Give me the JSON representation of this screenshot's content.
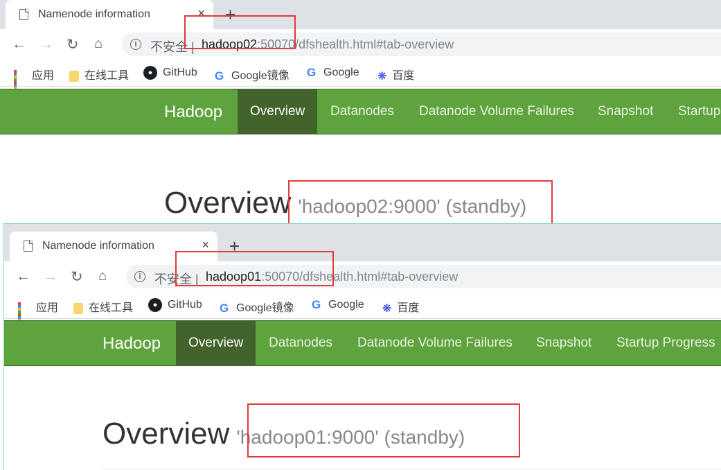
{
  "windows": [
    {
      "tab_title": "Namenode information",
      "tab_close": "×",
      "new_tab": "+",
      "insecure_label": "不安全 |",
      "url_host": "hadoop02",
      "url_rest": ":50070/dfshealth.html#tab-overview",
      "bookmarks": [
        "应用",
        "在线工具",
        "GitHub",
        "Google镜像",
        "Google",
        "百度"
      ],
      "brand": "Hadoop",
      "nav": [
        "Overview",
        "Datanodes",
        "Datanode Volume Failures",
        "Snapshot",
        "Startup Progress"
      ],
      "heading": "Overview",
      "subheading": "'hadoop02:9000' (standby)"
    },
    {
      "tab_title": "Namenode information",
      "tab_close": "×",
      "new_tab": "+",
      "insecure_label": "不安全 |",
      "url_host": "hadoop01",
      "url_rest": ":50070/dfshealth.html#tab-overview",
      "bookmarks": [
        "应用",
        "在线工具",
        "GitHub",
        "Google镜像",
        "Google",
        "百度"
      ],
      "brand": "Hadoop",
      "nav": [
        "Overview",
        "Datanodes",
        "Datanode Volume Failures",
        "Snapshot",
        "Startup Progress"
      ],
      "heading": "Overview",
      "subheading": "'hadoop01:9000' (standby)"
    }
  ],
  "icons": {
    "back": "back-arrow-icon",
    "forward": "forward-arrow-icon",
    "reload": "reload-icon",
    "home": "home-icon",
    "info": "info-icon",
    "document": "document-icon"
  },
  "colors": {
    "navbar": "#5fa33e",
    "navbar_active": "#43632d",
    "highlight_box": "#e23a3a"
  }
}
